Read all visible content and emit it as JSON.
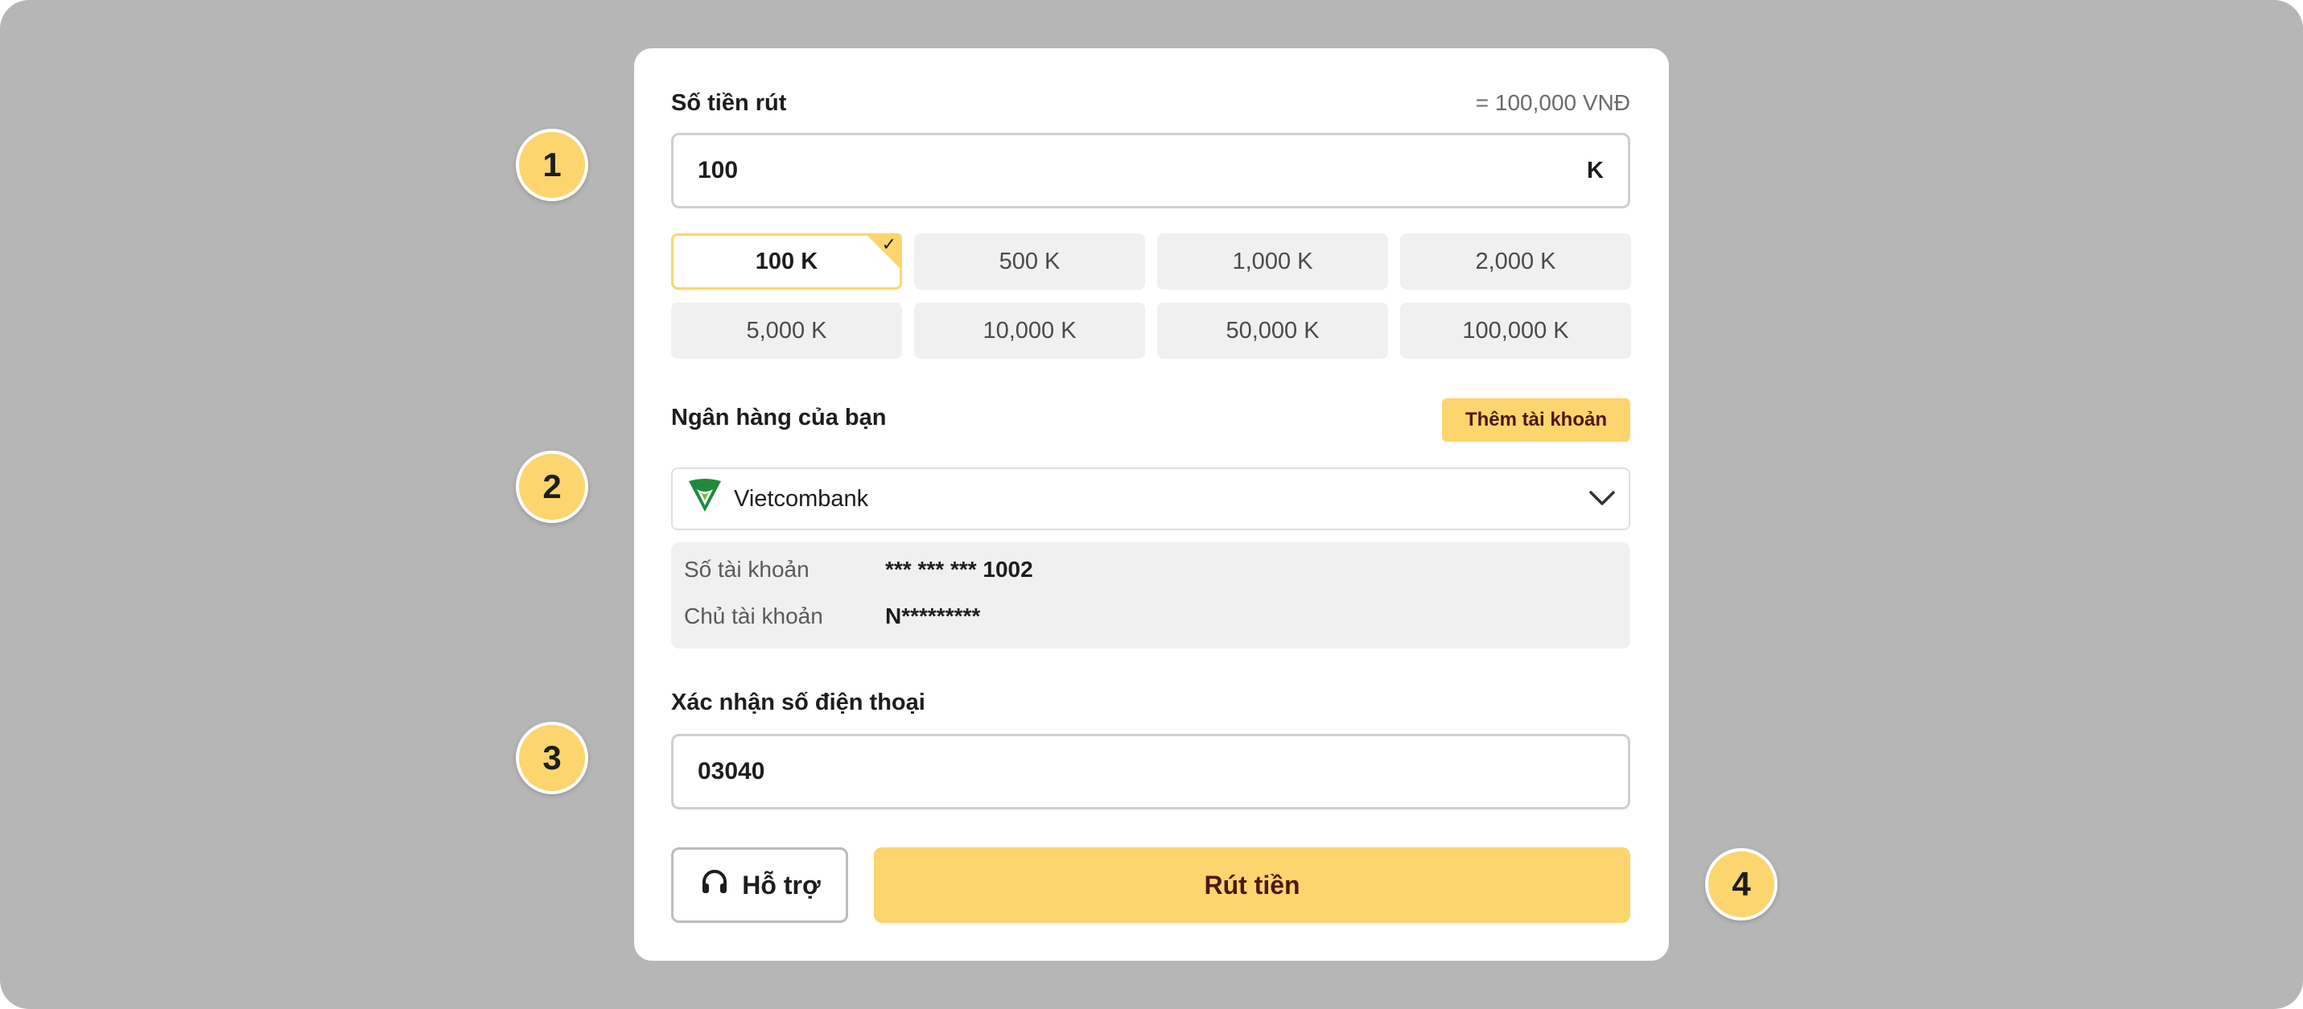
{
  "badges": [
    "1",
    "2",
    "3",
    "4"
  ],
  "amount": {
    "label": "Số tiền rút",
    "equivalent": "= 100,000 VNĐ",
    "value": "100",
    "unit": "K"
  },
  "presets": [
    {
      "label": "100 K",
      "selected": true
    },
    {
      "label": "500 K",
      "selected": false
    },
    {
      "label": "1,000 K",
      "selected": false
    },
    {
      "label": "2,000 K",
      "selected": false
    },
    {
      "label": "5,000 K",
      "selected": false
    },
    {
      "label": "10,000 K",
      "selected": false
    },
    {
      "label": "50,000 K",
      "selected": false
    },
    {
      "label": "100,000 K",
      "selected": false
    }
  ],
  "bank": {
    "label": "Ngân hàng của bạn",
    "add_account": "Thêm tài khoản",
    "selected_bank": "Vietcombank",
    "account_number_label": "Số tài khoản",
    "account_number": "*** *** *** 1002",
    "holder_label": "Chủ tài khoản",
    "holder": "N*********"
  },
  "phone": {
    "label": "Xác nhận số điện thoại",
    "value": "03040"
  },
  "actions": {
    "support": "Hỗ trợ",
    "withdraw": "Rút tiền"
  },
  "colors": {
    "background": "#b6b6b6",
    "accent": "#fcd56e",
    "button_text": "#4a1a12",
    "bank_logo": "#1f8a3c"
  },
  "icons": {
    "selected": "check-icon",
    "bank": "vietcombank-logo-icon",
    "dropdown": "chevron-down-icon",
    "support": "headset-icon"
  }
}
